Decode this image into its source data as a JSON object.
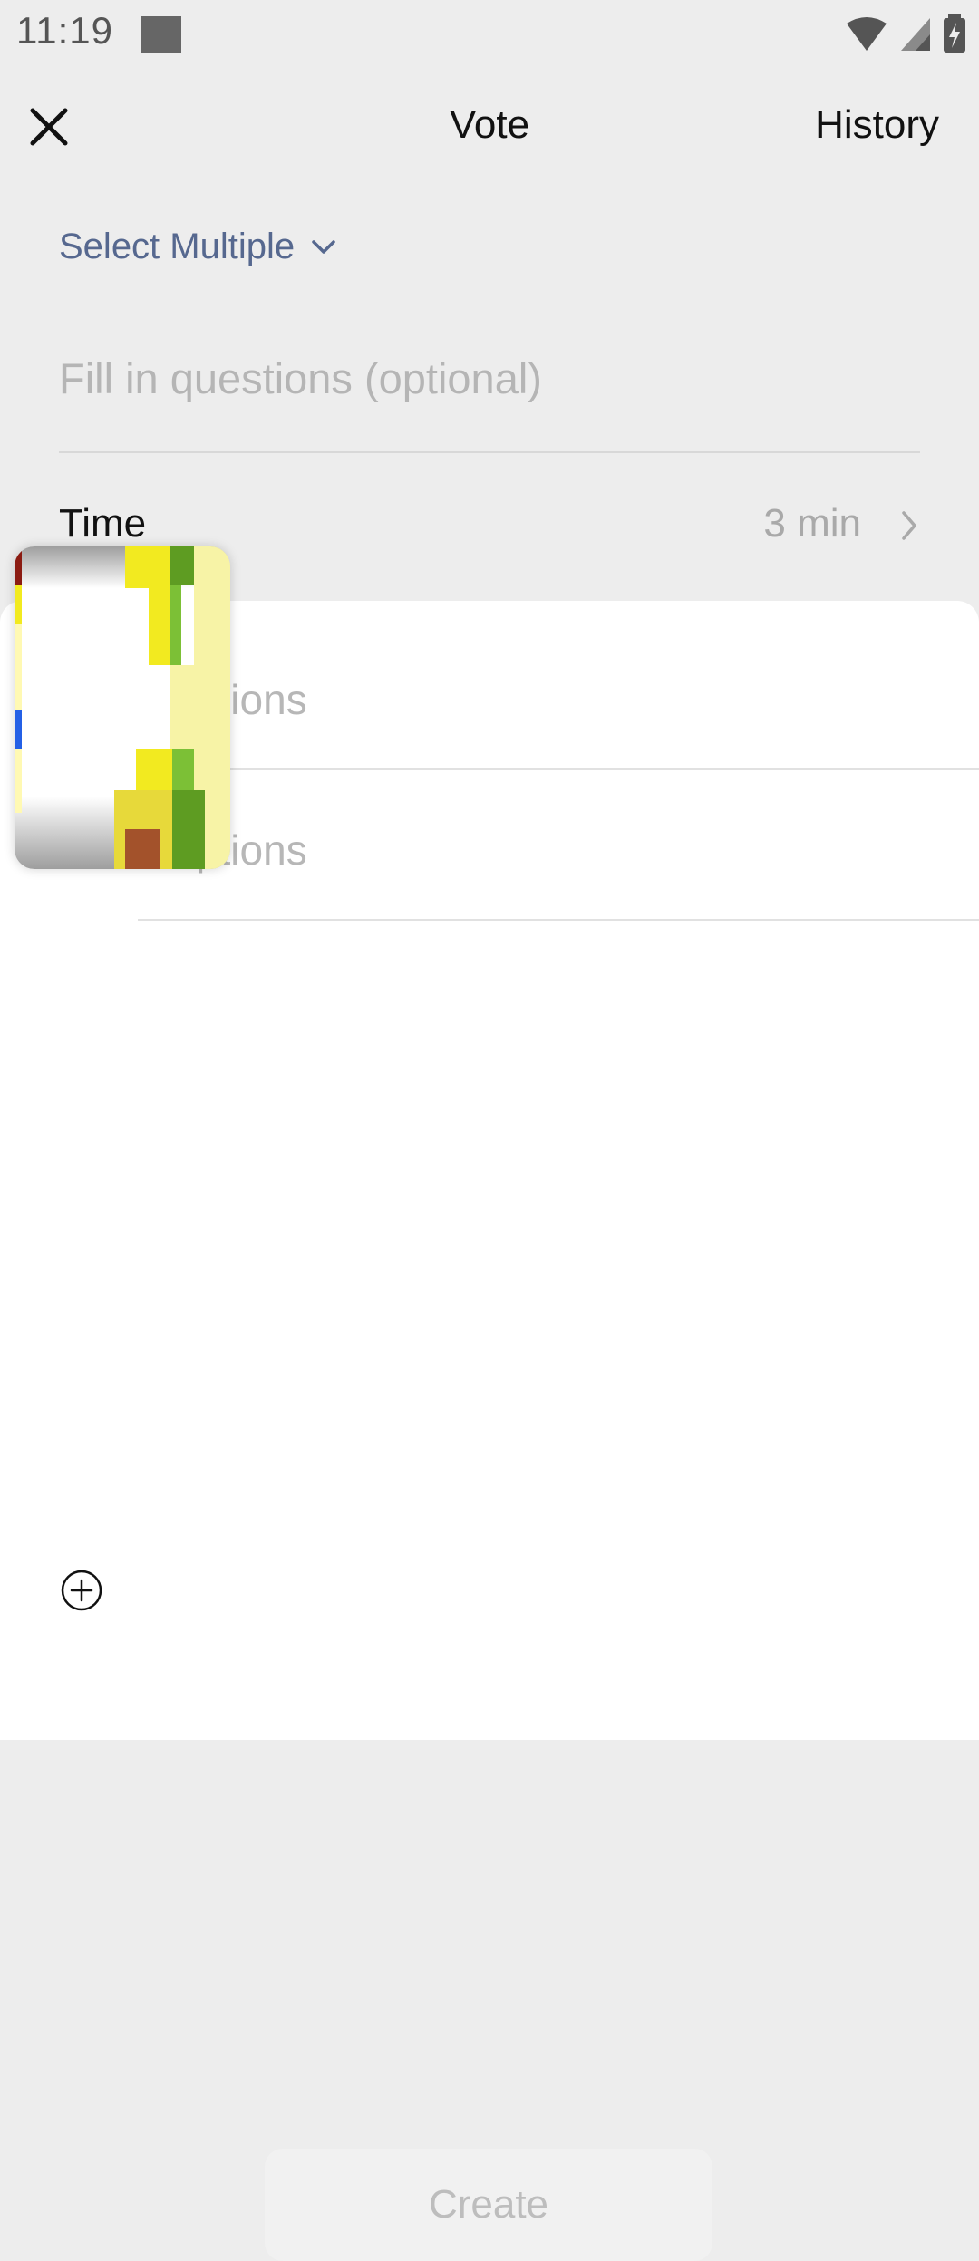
{
  "status_bar": {
    "time": "11:19",
    "icons": [
      "square-icon",
      "wifi-icon",
      "cell-signal-icon",
      "battery-charging-icon"
    ]
  },
  "header": {
    "close_icon": "close-icon",
    "title": "Vote",
    "history_label": "History"
  },
  "form": {
    "vote_mode_label": "Select Multiple",
    "vote_mode_icon": "chevron-down-icon",
    "question_placeholder": "Fill in questions (optional)",
    "time_label": "Time",
    "time_value": "3 min",
    "time_chevron_icon": "chevron-right-icon"
  },
  "options": {
    "items": [
      {
        "placeholder": "n options"
      },
      {
        "placeholder": "n options"
      }
    ],
    "add_icon": "plus-circle-icon"
  },
  "actions": {
    "create_label": "Create"
  },
  "colors": {
    "background": "#ededed",
    "accent": "#56688f",
    "placeholder": "#b5b5b5",
    "sheet": "#ffffff",
    "button_disabled_bg": "#f1f1f1",
    "button_disabled_text": "#bdbdbd"
  }
}
